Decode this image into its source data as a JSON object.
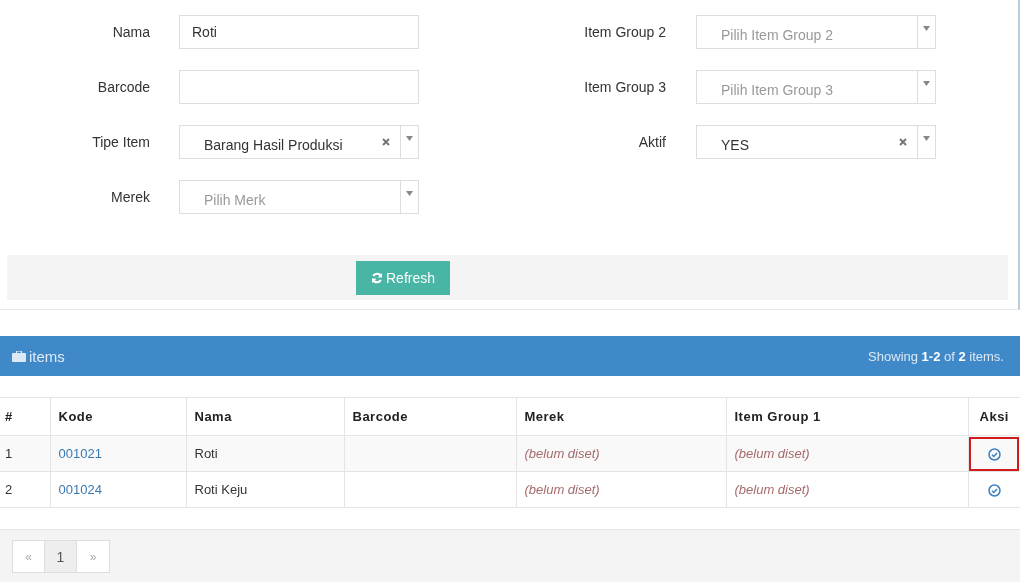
{
  "form": {
    "left": [
      {
        "label": "Nama",
        "kind": "text",
        "value": "Roti"
      },
      {
        "label": "Barcode",
        "kind": "text"
      },
      {
        "label": "Tipe Item",
        "kind": "select",
        "value": "Barang Hasil Produksi",
        "clearable": true
      },
      {
        "label": "Merek",
        "kind": "select",
        "placeholder": "Pilih Merk",
        "clearable": false
      }
    ],
    "right": [
      {
        "label": "Item Group 2",
        "kind": "select",
        "placeholder": "Pilih Item Group 2",
        "clearable": false
      },
      {
        "label": "Item Group 3",
        "kind": "select",
        "placeholder": "Pilih Item Group 3",
        "clearable": false
      },
      {
        "label": "Aktif",
        "kind": "select",
        "value": "YES",
        "clearable": true
      }
    ],
    "refresh_button": "Refresh"
  },
  "items_panel": {
    "title": "items",
    "summary": "Showing **1-2** of **2** items.",
    "table": {
      "columns": [
        "#",
        "Kode",
        "Nama",
        "Barcode",
        "Merek",
        "Item Group 1",
        "Aksi"
      ],
      "rows": [
        {
          "no": "1",
          "kode": "001021",
          "nama": "Roti",
          "barcode": "",
          "merek": "(belum diset)",
          "item_group_1": "(belum diset)",
          "highlighted": true
        },
        {
          "no": "2",
          "kode": "001024",
          "nama": "Roti Keju",
          "barcode": "",
          "merek": "(belum diset)",
          "item_group_1": "(belum diset)",
          "highlighted": false
        }
      ]
    },
    "pagination": [
      {
        "label": "«",
        "selected": false
      },
      {
        "label": "1",
        "selected": true
      },
      {
        "label": "»",
        "selected": false
      }
    ]
  }
}
